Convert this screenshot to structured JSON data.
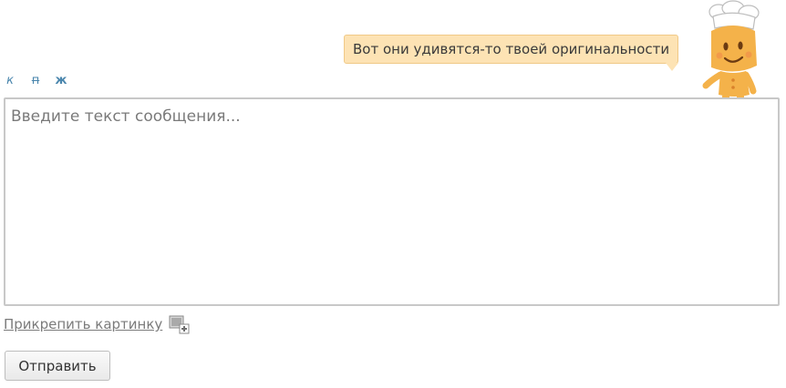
{
  "speech_bubble": {
    "text": "Вот они удивятся-то твоей оригинальности",
    "background_color": "#fde3b4"
  },
  "mascot": {
    "icon": "gingerbread-chef-icon"
  },
  "toolbar": {
    "italic_label": "к",
    "strike_label": "п",
    "bold_label": "ж",
    "link_color": "#4a86ad"
  },
  "message": {
    "placeholder": "Введите текст сообщения...",
    "value": ""
  },
  "attach": {
    "label": "Прикрепить картинку",
    "icon": "image-add-icon"
  },
  "submit": {
    "label": "Отправить"
  }
}
